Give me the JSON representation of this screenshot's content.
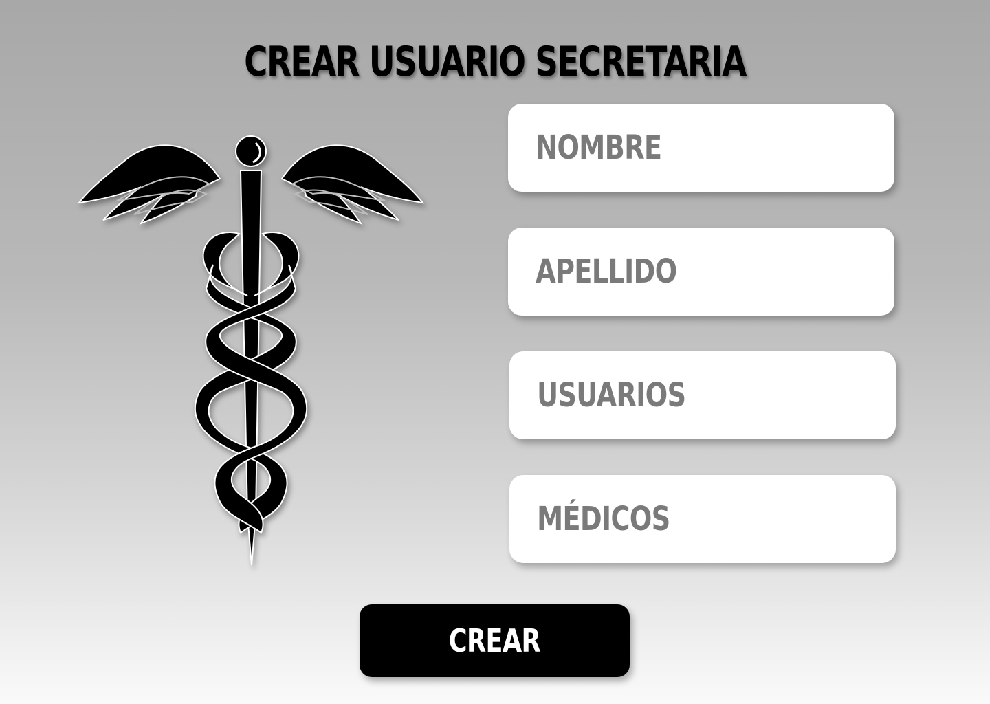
{
  "page": {
    "title": "CREAR USUARIO SECRETARIA"
  },
  "emblem": {
    "icon": "caduceus-icon"
  },
  "form": {
    "fields": [
      {
        "name": "nombre",
        "placeholder": "NOMBRE"
      },
      {
        "name": "apellido",
        "placeholder": "APELLIDO"
      },
      {
        "name": "usuarios",
        "placeholder": "USUARIOS"
      },
      {
        "name": "medicos",
        "placeholder": "MÉDICOS"
      }
    ],
    "submit_label": "CREAR"
  },
  "colors": {
    "background_top": "#a8a8a8",
    "background_bottom": "#fafafa",
    "field_background": "#ffffff",
    "field_text": "#7a7a7a",
    "button_background": "#000000",
    "button_text": "#ffffff"
  }
}
